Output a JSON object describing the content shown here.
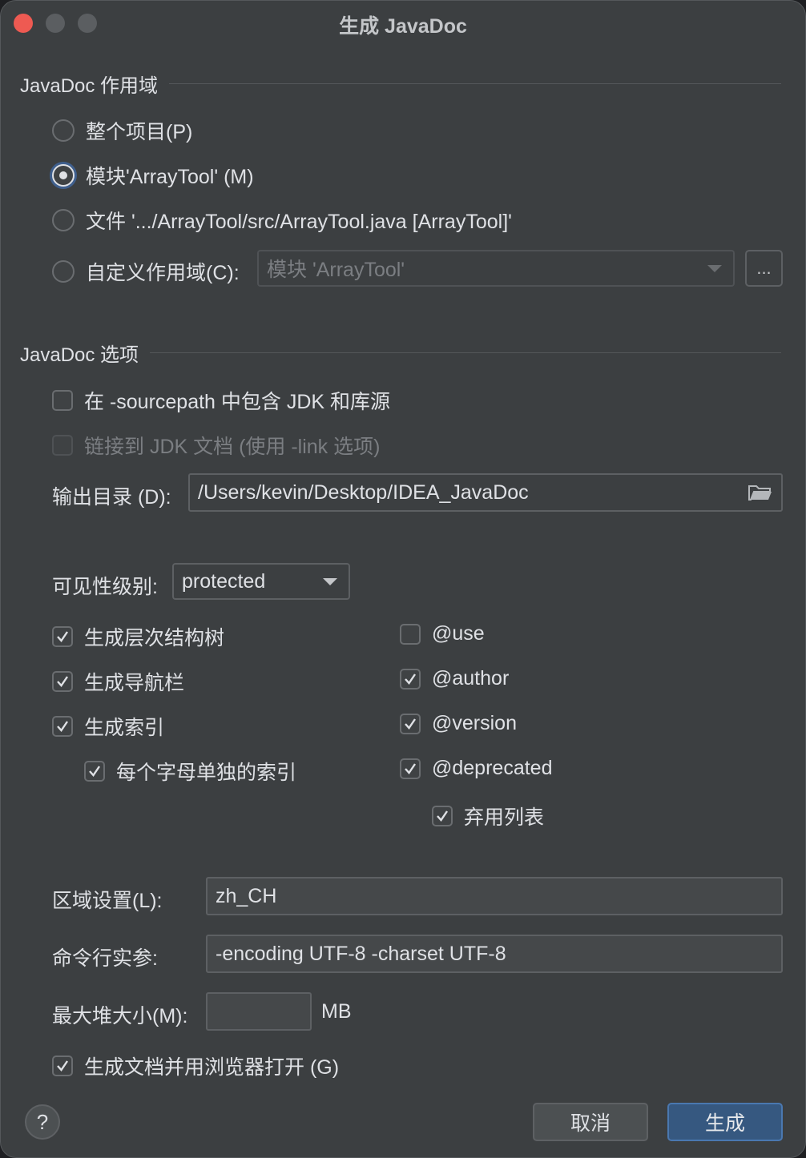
{
  "window": {
    "title": "生成 JavaDoc"
  },
  "scope": {
    "section_title": "JavaDoc 作用域",
    "options": [
      {
        "label": "整个项目(P)",
        "selected": false
      },
      {
        "label": "模块'ArrayTool' (M)",
        "selected": true
      },
      {
        "label": "文件 '.../ArrayTool/src/ArrayTool.java [ArrayTool]'",
        "selected": false
      },
      {
        "label": "自定义作用域(C):",
        "selected": false
      }
    ],
    "custom_scope_value": "模块 'ArrayTool'",
    "browse_label": "..."
  },
  "options": {
    "section_title": "JavaDoc 选项",
    "include_jdk_sources": {
      "label": "在 -sourcepath 中包含 JDK 和库源",
      "checked": false
    },
    "link_jdk_docs": {
      "label": "链接到 JDK 文档 (使用 -link 选项)",
      "checked": false,
      "enabled": false
    },
    "output_dir_label": "输出目录 (D):",
    "output_dir_value": "/Users/kevin/Desktop/IDEA_JavaDoc",
    "visibility_label": "可见性级别:",
    "visibility_value": "protected",
    "left_checks": [
      {
        "label": "生成层次结构树",
        "checked": true
      },
      {
        "label": "生成导航栏",
        "checked": true
      },
      {
        "label": "生成索引",
        "checked": true
      },
      {
        "label": "每个字母单独的索引",
        "checked": true
      }
    ],
    "right_checks": [
      {
        "label": "@use",
        "checked": false
      },
      {
        "label": "@author",
        "checked": true
      },
      {
        "label": "@version",
        "checked": true
      },
      {
        "label": "@deprecated",
        "checked": true
      },
      {
        "label": "弃用列表",
        "checked": true
      }
    ],
    "locale_label": "区域设置(L):",
    "locale_value": "zh_CH",
    "cmdline_label": "命令行实参:",
    "cmdline_value": "-encoding UTF-8 -charset UTF-8",
    "heap_label": "最大堆大小(M):",
    "heap_value": "",
    "heap_unit": "MB",
    "open_browser": {
      "label": "生成文档并用浏览器打开 (G)",
      "checked": true
    }
  },
  "footer": {
    "help_label": "?",
    "cancel_label": "取消",
    "ok_label": "生成"
  },
  "colors": {
    "window_bg": "#3c3f41",
    "accent_button": "#365880",
    "close_dot": "#ee5a52"
  }
}
